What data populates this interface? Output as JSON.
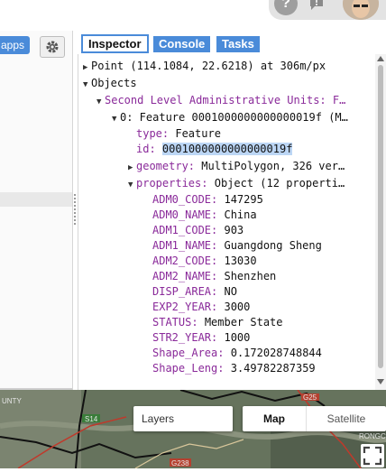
{
  "left_panel": {
    "apps_label": "apps"
  },
  "tabs": {
    "inspector": "Inspector",
    "console": "Console",
    "tasks": "Tasks"
  },
  "inspector": {
    "point_line": "Point (114.1084, 22.6218) at 306m/px",
    "objects_label": "Objects",
    "collection_label": "Second Level Administrative Units: F…",
    "feature_label": "0: Feature 0001000000000000019f (M…",
    "type_key": "type:",
    "type_value": "Feature",
    "id_key": "id:",
    "id_value": "0001000000000000019f",
    "geometry_key": "geometry:",
    "geometry_value": "MultiPolygon, 326 ver…",
    "properties_key": "properties:",
    "properties_value": "Object (12 properti…",
    "props": [
      {
        "key": "ADM0_CODE:",
        "value": "147295"
      },
      {
        "key": "ADM0_NAME:",
        "value": "China"
      },
      {
        "key": "ADM1_CODE:",
        "value": "903"
      },
      {
        "key": "ADM1_NAME:",
        "value": "Guangdong Sheng"
      },
      {
        "key": "ADM2_CODE:",
        "value": "13030"
      },
      {
        "key": "ADM2_NAME:",
        "value": "Shenzhen"
      },
      {
        "key": "DISP_AREA:",
        "value": "NO"
      },
      {
        "key": "EXP2_YEAR:",
        "value": "3000"
      },
      {
        "key": "STATUS:",
        "value": "Member State"
      },
      {
        "key": "STR2_YEAR:",
        "value": "1000"
      },
      {
        "key": "Shape_Area:",
        "value": "0.172028748844"
      },
      {
        "key": "Shape_Leng:",
        "value": "3.49782287359"
      }
    ]
  },
  "map": {
    "layers_label": "Layers",
    "map_label": "Map",
    "satellite_label": "Satellite",
    "labels": {
      "county": "UNTY",
      "s14": "S14",
      "g238": "G238",
      "g25": "G25",
      "rongc": "RONGC"
    }
  },
  "colors": {
    "accent": "#4a8bd9",
    "property_key": "#8a2a9a",
    "selection": "#bcd6f5",
    "map_road": "#c0392b"
  }
}
